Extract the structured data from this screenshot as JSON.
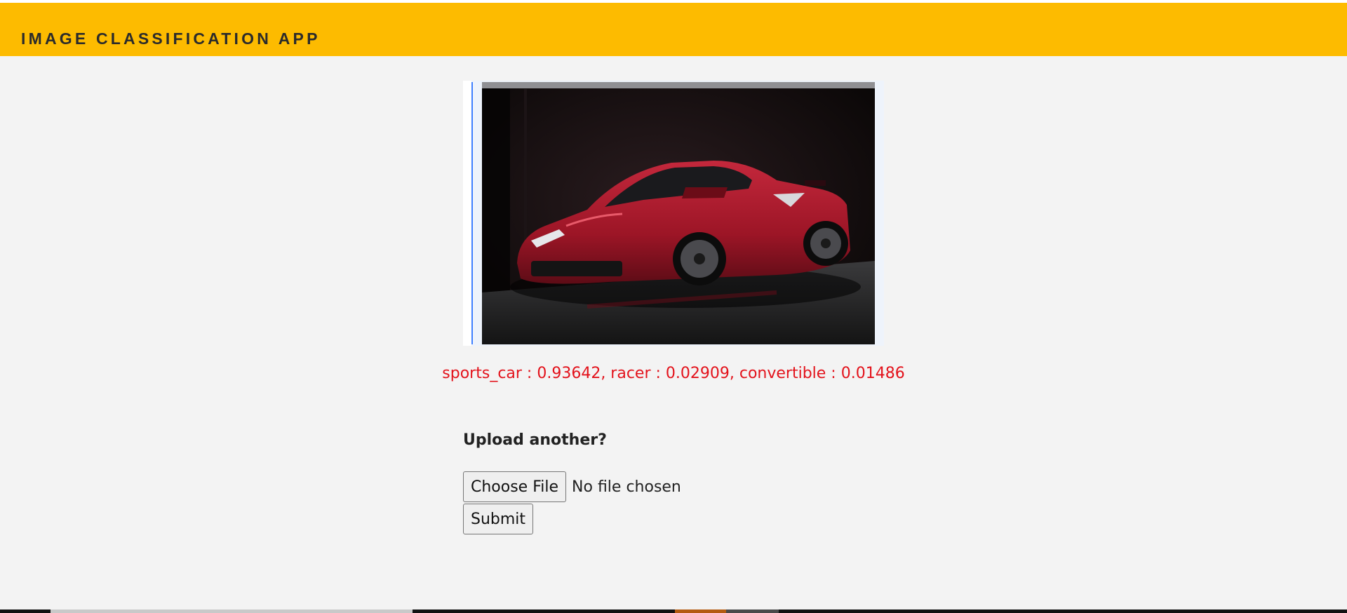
{
  "app": {
    "title": "IMAGE CLASSIFICATION APP",
    "accent_color": "#fdbb00"
  },
  "uploaded_image": {
    "alt": "red sports car",
    "icon": "car-photo"
  },
  "prediction": {
    "text": "sports_car : 0.93642, racer : 0.02909, convertible : 0.01486",
    "color": "#e3121b"
  },
  "upload_form": {
    "prompt": "Upload another?",
    "choose_file_label": "Choose File",
    "file_status": "No file chosen",
    "submit_label": "Submit"
  }
}
